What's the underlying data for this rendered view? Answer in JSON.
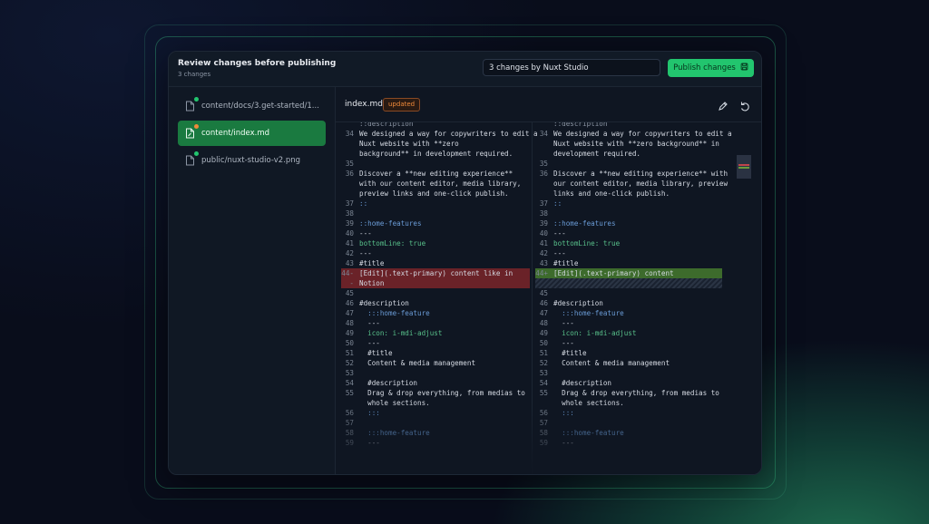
{
  "header": {
    "title": "Review changes before publishing",
    "subtitle": "3 changes",
    "commit_message": "3 changes by Nuxt Studio",
    "publish_label": "Publish changes"
  },
  "sidebar": {
    "items": [
      {
        "label": "content/docs/3.get-started/1...",
        "status": "added"
      },
      {
        "label": "content/index.md",
        "status": "updated"
      },
      {
        "label": "public/nuxt-studio-v2.png",
        "status": "added"
      }
    ]
  },
  "file": {
    "name": "index.md",
    "badge": "updated"
  },
  "icons": {
    "edit": "pencil-icon",
    "revert": "undo-icon",
    "save": "save-icon",
    "file": "file-icon"
  },
  "colors": {
    "accent": "#22c56e",
    "updated": "#f08a3a",
    "deleted_bg": "#6a2228",
    "added_bg": "#3d6b2c"
  },
  "diff": {
    "left": [
      {
        "n": "",
        "t": "::description"
      },
      {
        "n": "34",
        "t": "We designed a way for copywriters to edit a"
      },
      {
        "n": "",
        "t": "Nuxt website with **zero"
      },
      {
        "n": "",
        "t": "background** in development required."
      },
      {
        "n": "35",
        "t": ""
      },
      {
        "n": "36",
        "t": "Discover a **new editing experience**"
      },
      {
        "n": "",
        "t": "with our content editor, media library,"
      },
      {
        "n": "",
        "t": "preview links and one-click publish."
      },
      {
        "n": "37",
        "t": "::"
      },
      {
        "n": "38",
        "t": ""
      },
      {
        "n": "39",
        "t": "::home-features"
      },
      {
        "n": "40",
        "t": "---"
      },
      {
        "n": "41",
        "t": "bottomLine: true"
      },
      {
        "n": "42",
        "t": "---"
      },
      {
        "n": "43",
        "t": "#title"
      },
      {
        "n": "44-",
        "t": "[Edit](.text-primary) content like in"
      },
      {
        "n": "-",
        "t": "Notion"
      },
      {
        "n": "45",
        "t": ""
      },
      {
        "n": "46",
        "t": "#description"
      },
      {
        "n": "47",
        "t": "  :::home-feature"
      },
      {
        "n": "48",
        "t": "  ---"
      },
      {
        "n": "49",
        "t": "  icon: i-mdi-adjust"
      },
      {
        "n": "50",
        "t": "  ---"
      },
      {
        "n": "51",
        "t": "  #title"
      },
      {
        "n": "52",
        "t": "  Content & media management"
      },
      {
        "n": "53",
        "t": ""
      },
      {
        "n": "54",
        "t": "  #description"
      },
      {
        "n": "55",
        "t": "  Drag & drop everything, from medias to"
      },
      {
        "n": "",
        "t": "  whole sections."
      },
      {
        "n": "56",
        "t": "  :::"
      },
      {
        "n": "57",
        "t": ""
      },
      {
        "n": "58",
        "t": "  :::home-feature"
      },
      {
        "n": "59",
        "t": "  ---"
      }
    ],
    "right": [
      {
        "n": "",
        "t": "::description"
      },
      {
        "n": "34",
        "t": "We designed a way for copywriters to edit a"
      },
      {
        "n": "",
        "t": "Nuxt website with **zero background** in"
      },
      {
        "n": "",
        "t": "development required."
      },
      {
        "n": "35",
        "t": ""
      },
      {
        "n": "36",
        "t": "Discover a **new editing experience** with"
      },
      {
        "n": "",
        "t": "our content editor, media library, preview"
      },
      {
        "n": "",
        "t": "links and one-click publish."
      },
      {
        "n": "37",
        "t": "::"
      },
      {
        "n": "38",
        "t": ""
      },
      {
        "n": "39",
        "t": "::home-features"
      },
      {
        "n": "40",
        "t": "---"
      },
      {
        "n": "41",
        "t": "bottomLine: true"
      },
      {
        "n": "42",
        "t": "---"
      },
      {
        "n": "43",
        "t": "#title"
      },
      {
        "n": "44+",
        "t": "[Edit](.text-primary) content"
      },
      {
        "n": "",
        "t": ""
      },
      {
        "n": "45",
        "t": ""
      },
      {
        "n": "46",
        "t": "#description"
      },
      {
        "n": "47",
        "t": "  :::home-feature"
      },
      {
        "n": "48",
        "t": "  ---"
      },
      {
        "n": "49",
        "t": "  icon: i-mdi-adjust"
      },
      {
        "n": "50",
        "t": "  ---"
      },
      {
        "n": "51",
        "t": "  #title"
      },
      {
        "n": "52",
        "t": "  Content & media management"
      },
      {
        "n": "53",
        "t": ""
      },
      {
        "n": "54",
        "t": "  #description"
      },
      {
        "n": "55",
        "t": "  Drag & drop everything, from medias to"
      },
      {
        "n": "",
        "t": "  whole sections."
      },
      {
        "n": "56",
        "t": "  :::"
      },
      {
        "n": "57",
        "t": ""
      },
      {
        "n": "58",
        "t": "  :::home-feature"
      },
      {
        "n": "59",
        "t": "  ---"
      }
    ]
  }
}
